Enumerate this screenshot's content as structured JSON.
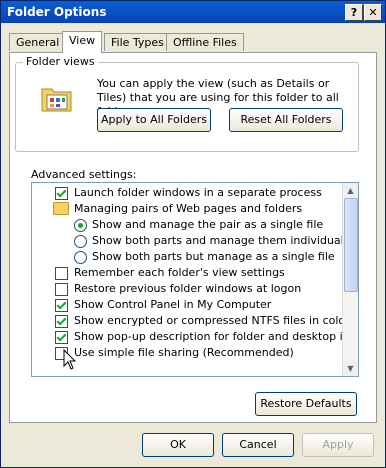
{
  "window": {
    "title": "Folder Options",
    "help_label": "?",
    "close_label": "✕"
  },
  "tabs": [
    {
      "label": "General"
    },
    {
      "label": "View"
    },
    {
      "label": "File Types"
    },
    {
      "label": "Offline Files"
    }
  ],
  "folder_views": {
    "title": "Folder views",
    "description": "You can apply the view (such as Details or Tiles) that you are using for this folder to all folders.",
    "apply_label": "Apply to All Folders",
    "reset_label": "Reset All Folders"
  },
  "advanced": {
    "label": "Advanced settings:",
    "items": [
      {
        "type": "checkbox",
        "checked": true,
        "label": "Launch folder windows in a separate process"
      },
      {
        "type": "folder",
        "label": "Managing pairs of Web pages and folders"
      },
      {
        "type": "radio",
        "checked": true,
        "label": "Show and manage the pair as a single file"
      },
      {
        "type": "radio",
        "checked": false,
        "label": "Show both parts and manage them individually"
      },
      {
        "type": "radio",
        "checked": false,
        "label": "Show both parts but manage as a single file"
      },
      {
        "type": "checkbox",
        "checked": false,
        "label": "Remember each folder's view settings"
      },
      {
        "type": "checkbox",
        "checked": false,
        "label": "Restore previous folder windows at logon"
      },
      {
        "type": "checkbox",
        "checked": true,
        "label": "Show Control Panel in My Computer"
      },
      {
        "type": "checkbox",
        "checked": true,
        "label": "Show encrypted or compressed NTFS files in color"
      },
      {
        "type": "checkbox",
        "checked": true,
        "label": "Show pop-up description for folder and desktop items"
      },
      {
        "type": "checkbox",
        "checked": false,
        "label": "Use simple file sharing (Recommended)"
      }
    ],
    "restore_label": "Restore Defaults"
  },
  "footer": {
    "ok_label": "OK",
    "cancel_label": "Cancel",
    "apply_label": "Apply"
  }
}
